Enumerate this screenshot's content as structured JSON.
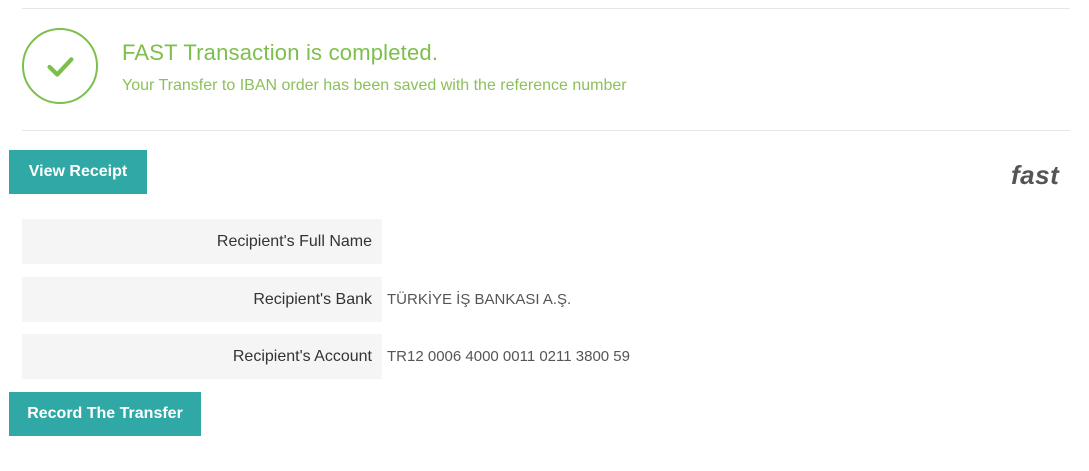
{
  "status": {
    "title": "FAST Transaction is completed.",
    "subtitle": "Your Transfer to IBAN order has been saved with the reference number",
    "icon": "checkmark-circle-icon",
    "color": "#7cbf4b"
  },
  "actions": {
    "view_receipt": "View Receipt",
    "record_transfer": "Record The Transfer",
    "button_color": "#2fa8a6"
  },
  "brand": {
    "logo_text": "fast"
  },
  "details": [
    {
      "label": "Recipient's Full Name",
      "value": ""
    },
    {
      "label": "Recipient's Bank",
      "value": "TÜRKİYE İŞ BANKASI A.Ş."
    },
    {
      "label": "Recipient's Account",
      "value": "TR12 0006 4000 0011 0211 3800 59"
    }
  ]
}
